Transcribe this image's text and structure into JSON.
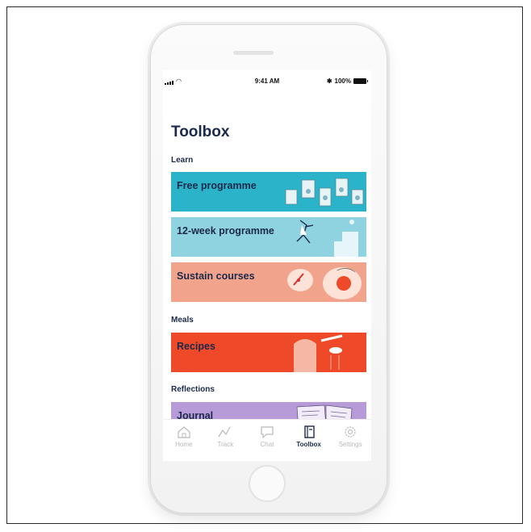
{
  "status_bar": {
    "time": "9:41 AM",
    "battery": "100%",
    "bluetooth": "✱"
  },
  "page": {
    "title": "Toolbox"
  },
  "sections": {
    "learn": "Learn",
    "meals": "Meals",
    "reflections": "Reflections"
  },
  "cards": {
    "free": {
      "label": "Free programme",
      "color": "#2bb3c9"
    },
    "twelve_week": {
      "label": "12-week programme",
      "color": "#8fd2e0"
    },
    "sustain": {
      "label": "Sustain courses",
      "color": "#f2a38b"
    },
    "recipes": {
      "label": "Recipes",
      "color": "#ee4a2a"
    },
    "journal": {
      "label": "Journal",
      "color": "#b79ad8"
    }
  },
  "tabs": [
    {
      "label": "Home",
      "icon": "home-icon",
      "active": false
    },
    {
      "label": "Track",
      "icon": "chart-line-icon",
      "active": false
    },
    {
      "label": "Chat",
      "icon": "chat-bubble-icon",
      "active": false
    },
    {
      "label": "Toolbox",
      "icon": "book-icon",
      "active": true
    },
    {
      "label": "Settings",
      "icon": "gear-icon",
      "active": false
    }
  ]
}
